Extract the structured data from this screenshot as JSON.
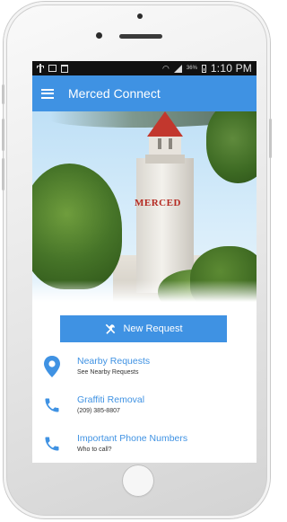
{
  "status_bar": {
    "battery_percent": "36%",
    "time": "1:10 PM",
    "icons": [
      "usb-icon",
      "gallery-icon",
      "notes-icon",
      "wifi-icon",
      "signal-icon",
      "battery-icon"
    ]
  },
  "app_bar": {
    "title": "Merced Connect",
    "menu_icon": "hamburger-menu-icon",
    "background": "#3f92e3"
  },
  "hero": {
    "sign_text": "MERCED"
  },
  "new_request": {
    "label": "New Request",
    "icon": "tools-icon"
  },
  "menu": {
    "items": [
      {
        "title": "Nearby Requests",
        "subtitle": "See Nearby Requests",
        "icon": "location-pin-icon"
      },
      {
        "title": "Graffiti Removal",
        "subtitle": "(209) 385-8807",
        "icon": "phone-icon"
      },
      {
        "title": "Important Phone Numbers",
        "subtitle": "Who to call?",
        "icon": "phone-icon"
      }
    ]
  },
  "colors": {
    "accent": "#3f92e3",
    "status_bar": "#111111",
    "spire": "#c2372d",
    "sign": "#b52a22"
  }
}
